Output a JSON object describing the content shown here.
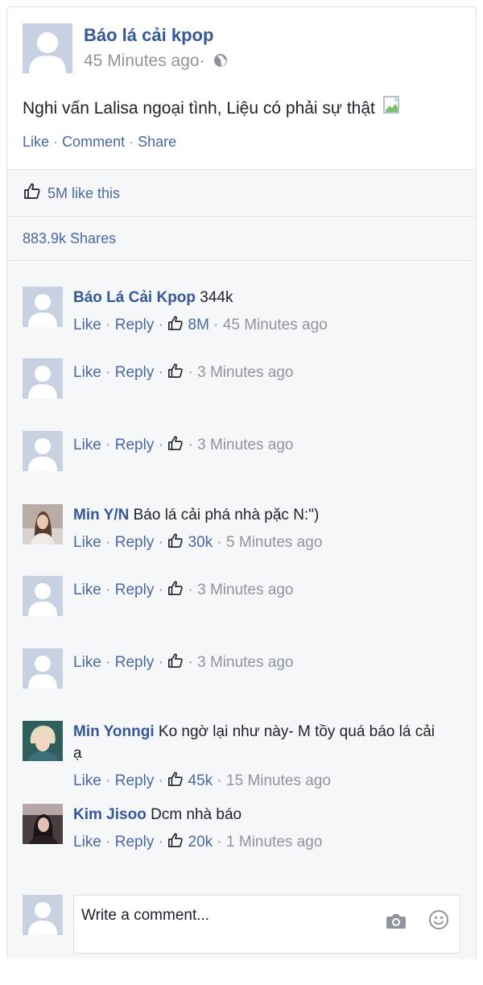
{
  "post": {
    "author": "Báo lá cải kpop",
    "time": "45 Minutes ago·",
    "text": "Nghi vấn Lalisa ngoại tình, Liệu có phải sự thật",
    "actions": {
      "like": "Like",
      "comment": "Comment",
      "share": "Share",
      "sep": "·"
    },
    "likes": "5M like this",
    "shares": "883.9k Shares"
  },
  "comments": [
    {
      "name": "Báo Lá Cải Kpop",
      "text": "344k",
      "like": "Like",
      "reply": "Reply",
      "count": "8M",
      "time": "45 Minutes ago",
      "avatar": "default"
    },
    {
      "name": "",
      "text": "",
      "like": "Like",
      "reply": "Reply",
      "count": "",
      "time": "3 Minutes ago",
      "avatar": "default"
    },
    {
      "name": "",
      "text": "",
      "like": "Like",
      "reply": "Reply",
      "count": "",
      "time": "3 Minutes ago",
      "avatar": "default"
    },
    {
      "name": "Min Y/N",
      "text": "Báo lá cải phá nhà pặc N:\")",
      "like": "Like",
      "reply": "Reply",
      "count": "30k",
      "time": "5 Minutes ago",
      "avatar": "photo-girl-long-hair"
    },
    {
      "name": "",
      "text": "",
      "like": "Like",
      "reply": "Reply",
      "count": "",
      "time": "3 Minutes ago",
      "avatar": "default"
    },
    {
      "name": "",
      "text": "",
      "like": "Like",
      "reply": "Reply",
      "count": "",
      "time": "3 Minutes ago",
      "avatar": "default"
    },
    {
      "name": "Min Yonngi",
      "text": "Ko ngờ lại như này- M tồy quá báo lá cải ạ",
      "like": "Like",
      "reply": "Reply",
      "count": "45k",
      "time": "15 Minutes ago",
      "avatar": "photo-blond-man"
    },
    {
      "name": "Kim Jisoo",
      "text": "Dcm nhà báo",
      "like": "Like",
      "reply": "Reply",
      "count": "20k",
      "time": "1 Minutes ago",
      "avatar": "photo-woman-dark"
    }
  ],
  "composer": {
    "placeholder": "Write a comment...",
    "camera_icon": "camera-icon",
    "emoji_icon": "smiley-icon"
  },
  "colors": {
    "link": "#4b67a1",
    "name": "#365899",
    "muted": "#90949c",
    "panel": "#f6f7f9",
    "avatar": "#c8d1e1"
  }
}
